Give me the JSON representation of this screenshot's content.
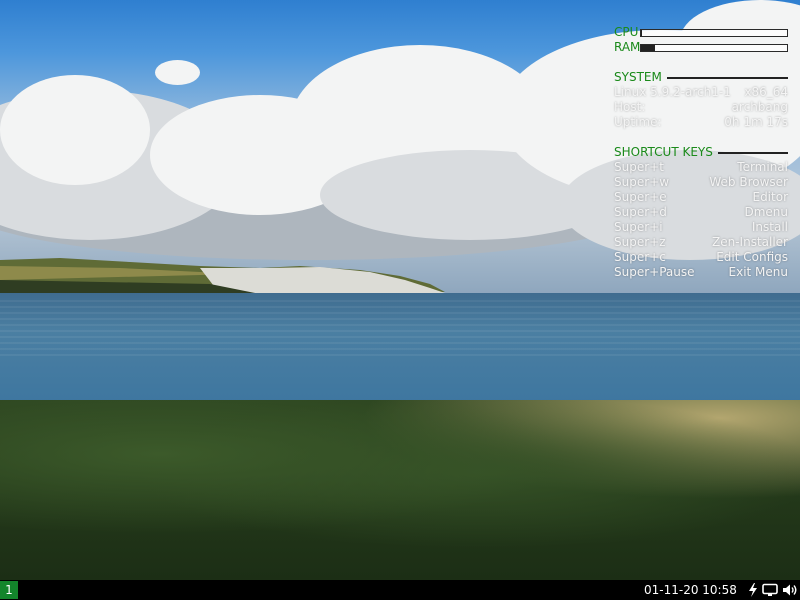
{
  "conky": {
    "cpu_label": "CPU",
    "cpu_usage": 0.01,
    "ram_label": "RAM",
    "ram_usage": 0.09,
    "system_heading": "SYSTEM",
    "kernel": "Linux 5.9.2-arch1-1",
    "arch": "x86_64",
    "host_label": "Host:",
    "host_value": "archbang",
    "uptime_label": "Uptime:",
    "uptime_value": "0h 1m 17s",
    "shortcuts_heading": "SHORTCUT KEYS",
    "shortcuts": [
      {
        "key": "Super+t",
        "action": "Terminal"
      },
      {
        "key": "Super+w",
        "action": "Web Browser"
      },
      {
        "key": "Super+e",
        "action": "Editor"
      },
      {
        "key": "Super+d",
        "action": "Dmenu"
      },
      {
        "key": "Super+i",
        "action": "Install"
      },
      {
        "key": "Super+z",
        "action": "Zen-Installer"
      },
      {
        "key": "Super+c",
        "action": "Edit Configs"
      },
      {
        "key": "Super+Pause",
        "action": "Exit Menu"
      }
    ]
  },
  "taskbar": {
    "workspace": "1",
    "clock": "01-11-20 10:58",
    "tray_icons": [
      "power-bolt-icon",
      "display-icon",
      "volume-icon"
    ]
  },
  "colors": {
    "accent_green": "#1a8a1a",
    "workspace_green": "#13852b",
    "taskbar_bg": "#000000"
  }
}
